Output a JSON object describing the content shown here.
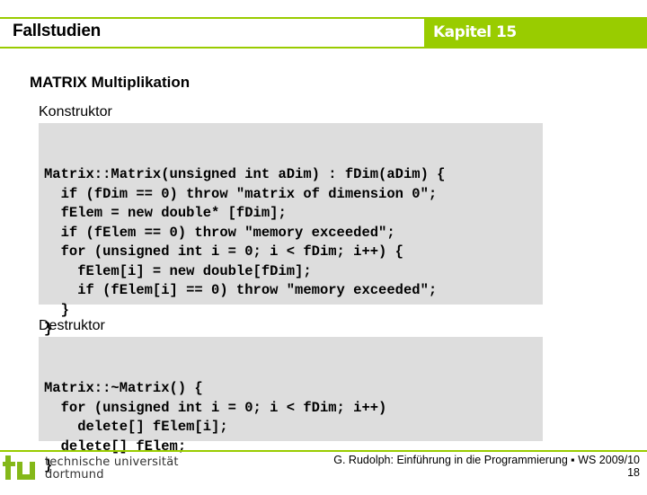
{
  "header": {
    "title": "Fallstudien",
    "chapter": "Kapitel 15",
    "accent_color": "#99cc00"
  },
  "section_title": "MATRIX Multiplikation",
  "constructor": {
    "label": "Konstruktor",
    "code": [
      "Matrix::Matrix(unsigned int aDim) : fDim(aDim) {",
      "  if (fDim == 0) throw \"matrix of dimension 0\";",
      "  fElem = new double* [fDim];",
      "  if (fElem == 0) throw \"memory exceeded\";",
      "  for (unsigned int i = 0; i < fDim; i++) {",
      "    fElem[i] = new double[fDim];",
      "    if (fElem[i] == 0) throw \"memory exceeded\";",
      "  }",
      "}"
    ]
  },
  "destructor": {
    "label": "Destruktor",
    "code": [
      "Matrix::~Matrix() {",
      "  for (unsigned int i = 0; i < fDim; i++)",
      "    delete[] fElem[i];",
      "  delete[] fElem;",
      "}"
    ]
  },
  "footer": {
    "logo_icon": "tu-logo-icon",
    "university_line1": "technische universität",
    "university_line2": "dortmund",
    "citation": "G. Rudolph: Einführung in die Programmierung ▪ WS 2009/10",
    "page_number": "18"
  }
}
